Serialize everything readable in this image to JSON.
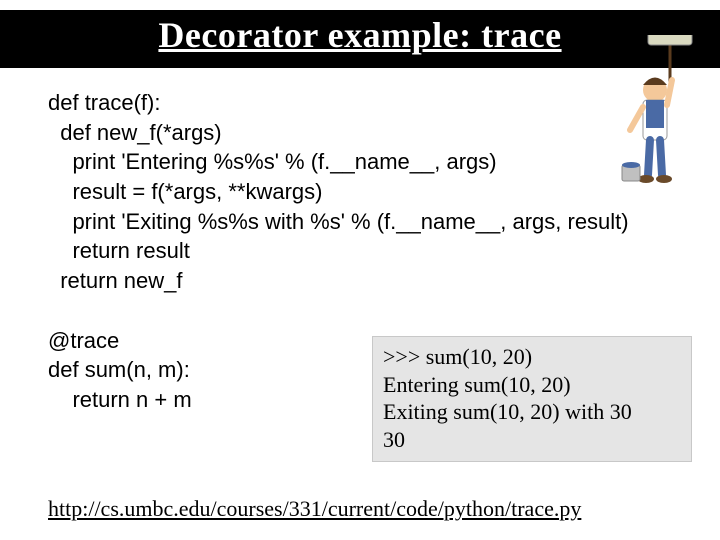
{
  "title": "Decorator example: trace",
  "code_lines": [
    "def trace(f):",
    "  def new_f(*args)",
    "    print 'Entering %s%s' % (f.__name__, args)",
    "    result = f(*args, **kwargs)",
    "    print 'Exiting %s%s with %s' % (f.__name__, args, result)",
    "    return result",
    "  return new_f",
    "",
    "@trace",
    "def sum(n, m):",
    "    return n + m"
  ],
  "output_lines": [
    ">>> sum(10, 20)",
    "Entering sum(10, 20)",
    "Exiting sum(10, 20) with 30",
    "30"
  ],
  "link": "http://cs.umbc.edu/courses/331/current/code/python/trace.py"
}
